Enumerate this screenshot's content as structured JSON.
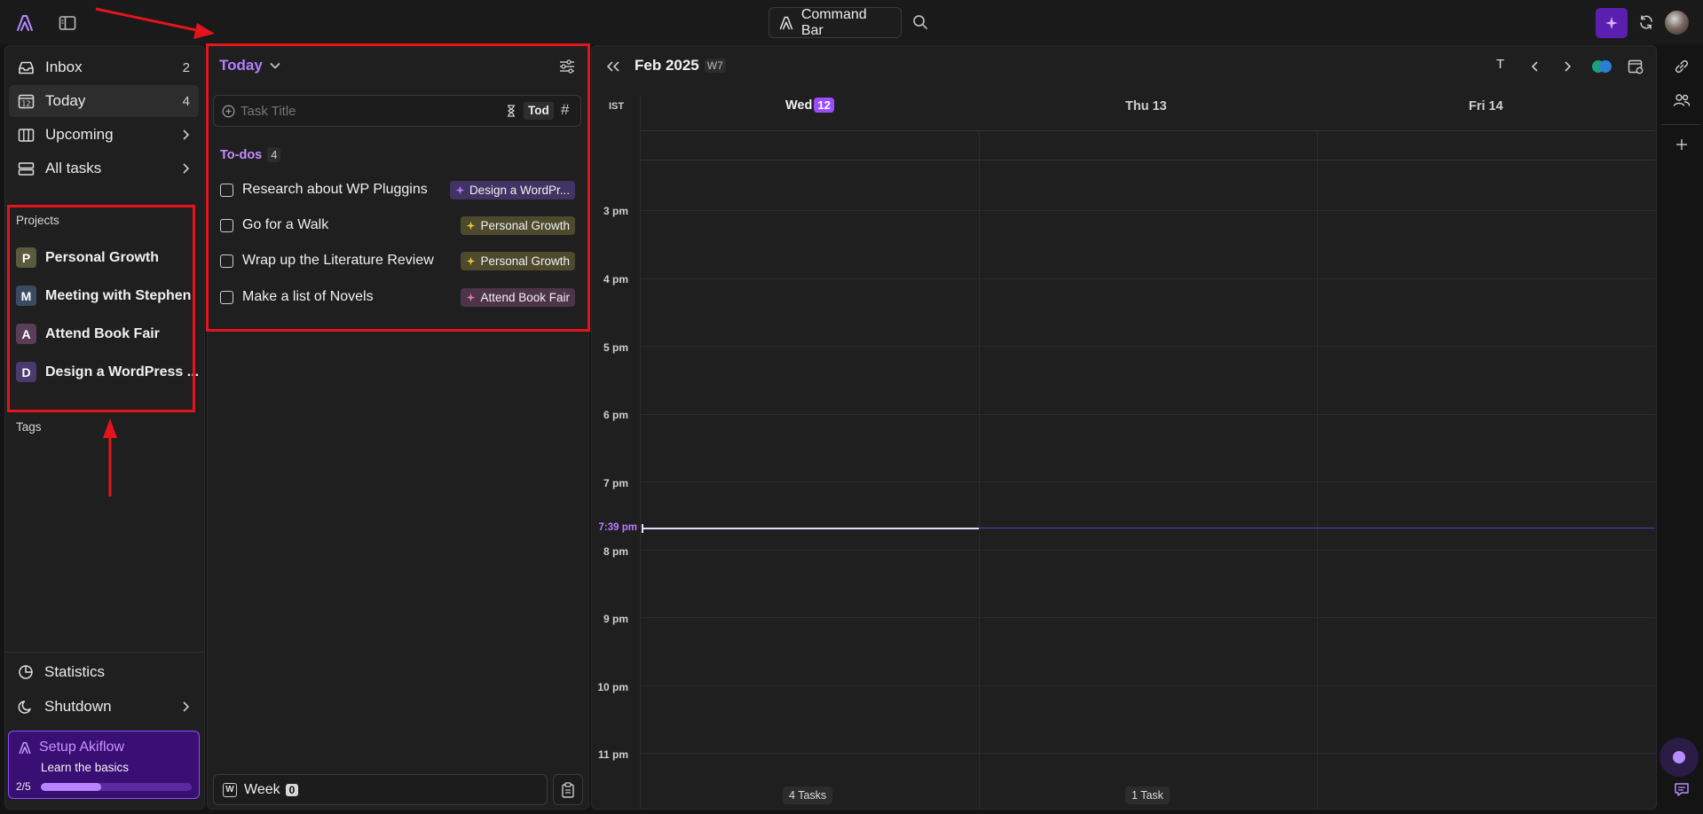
{
  "topbar": {
    "command_bar_label": "Command Bar"
  },
  "sidebar": {
    "nav": [
      {
        "label": "Inbox",
        "count": "2"
      },
      {
        "label": "Today",
        "count": "4"
      },
      {
        "label": "Upcoming"
      },
      {
        "label": "All tasks"
      }
    ],
    "projects_heading": "Projects",
    "projects": [
      {
        "initial": "P",
        "name": "Personal Growth",
        "color": "#5b5a3c"
      },
      {
        "initial": "M",
        "name": "Meeting with Stephen",
        "color": "#3b4a63"
      },
      {
        "initial": "A",
        "name": "Attend Book Fair",
        "color": "#5a3e57"
      },
      {
        "initial": "D",
        "name": "Design a WordPress ...",
        "color": "#4a3a6e"
      }
    ],
    "tags_heading": "Tags",
    "statistics_label": "Statistics",
    "shutdown_label": "Shutdown",
    "setup": {
      "title": "Setup Akiflow",
      "subtitle": "Learn the basics",
      "progress_text": "2/5",
      "progress": 0.4
    }
  },
  "today_panel": {
    "title": "Today",
    "task_input_placeholder": "Task Title",
    "tod_label": "Tod",
    "hash_label": "#",
    "todos_label": "To-dos",
    "todos_count": "4",
    "todos": [
      {
        "title": "Research about WP Pluggins",
        "tag": "Design a WordPr...",
        "tag_bg": "#3f3462",
        "tag_icon_color": "#b37cff"
      },
      {
        "title": "Go for a Walk",
        "tag": "Personal Growth",
        "tag_bg": "#4e4a2e",
        "tag_icon_color": "#f1c232"
      },
      {
        "title": "Wrap up the Literature Review",
        "tag": "Personal Growth",
        "tag_bg": "#4e4a2e",
        "tag_icon_color": "#f1c232"
      },
      {
        "title": "Make a list of Novels",
        "tag": "Attend Book Fair",
        "tag_bg": "#4d3448",
        "tag_icon_color": "#e07ab8"
      }
    ],
    "week_key": "W",
    "week_label": "Week",
    "week_count": "0"
  },
  "calendar": {
    "month": "Feb 2025",
    "week_badge": "W7",
    "today_key": "T",
    "timezone": "IST",
    "days": [
      {
        "label": "Wed",
        "num": "12",
        "today": true,
        "footer": "4 Tasks"
      },
      {
        "label": "Thu 13",
        "num": "",
        "today": false,
        "footer": "1 Task"
      },
      {
        "label": "Fri 14",
        "num": "",
        "today": false,
        "footer": ""
      }
    ],
    "hours": [
      "3 pm",
      "4 pm",
      "5 pm",
      "6 pm",
      "7 pm",
      "8 pm",
      "9 pm",
      "10 pm",
      "11 pm"
    ],
    "now_label": "7:39 pm",
    "accent": "#a259ff"
  }
}
